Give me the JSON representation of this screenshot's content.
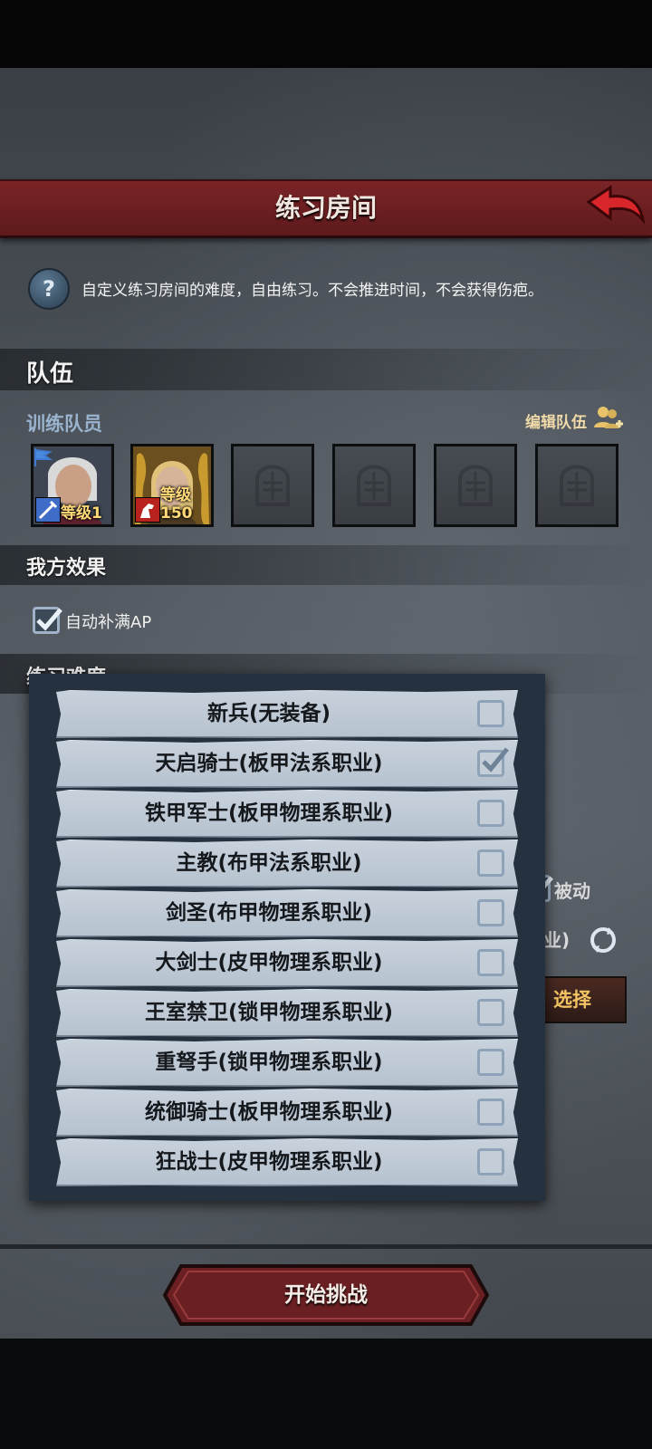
{
  "header": {
    "title": "练习房间"
  },
  "hint": {
    "text": "自定义练习房间的难度，自由练习。不会推进时间，不会获得伤疤。"
  },
  "team": {
    "section_title": "队伍",
    "members_label": "训练队员",
    "edit_label": "编辑队伍",
    "members": [
      {
        "level": "等级1",
        "class_icon": "sword-icon"
      },
      {
        "level": "等级150",
        "class_icon": "horse-icon"
      }
    ]
  },
  "effects": {
    "section_title": "我方效果",
    "auto_fill_ap": {
      "label": "自动补满AP",
      "checked": true
    }
  },
  "difficulty": {
    "section_title": "练习难度"
  },
  "behind": {
    "passive_label": "被动",
    "job_fragment": "系职业)",
    "select_label": "选择"
  },
  "dropdown": {
    "options": [
      {
        "label": "新兵(无装备)",
        "checked": false
      },
      {
        "label": "天启骑士(板甲法系职业)",
        "checked": true
      },
      {
        "label": "铁甲军士(板甲物理系职业)",
        "checked": false
      },
      {
        "label": "主教(布甲法系职业)",
        "checked": false
      },
      {
        "label": "剑圣(布甲物理系职业)",
        "checked": false
      },
      {
        "label": "大剑士(皮甲物理系职业)",
        "checked": false
      },
      {
        "label": "王室禁卫(锁甲物理系职业)",
        "checked": false
      },
      {
        "label": "重弩手(锁甲物理系职业)",
        "checked": false
      },
      {
        "label": "统御骑士(板甲物理系职业)",
        "checked": false
      },
      {
        "label": "狂战士(皮甲物理系职业)",
        "checked": false
      }
    ]
  },
  "footer": {
    "start_label": "开始挑战"
  },
  "colors": {
    "header": "#6b1f21",
    "accent_gold": "#f2c463",
    "panel": "#263140"
  }
}
